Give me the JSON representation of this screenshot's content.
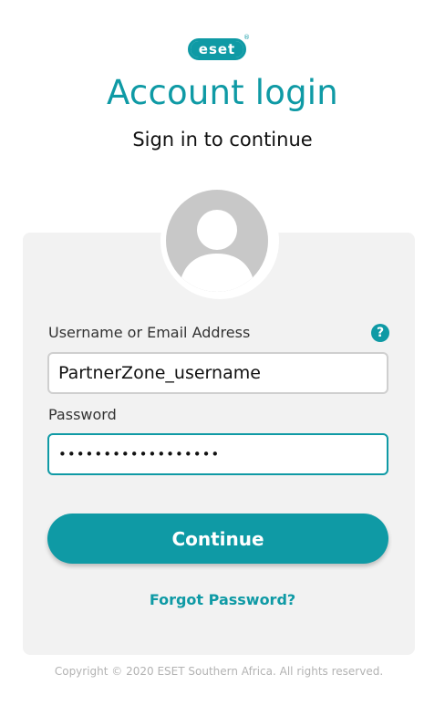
{
  "brand": {
    "logo_text": "eset",
    "registered_mark": "®",
    "accent_color": "#0f9aa5"
  },
  "header": {
    "title": "Account login",
    "subtitle": "Sign in to continue"
  },
  "avatar": {
    "icon": "user-silhouette-icon"
  },
  "form": {
    "username_label": "Username or Email Address",
    "help_icon_glyph": "?",
    "username_value": "PartnerZone_username",
    "password_label": "Password",
    "password_value": "••••••••••••••••••",
    "continue_label": "Continue",
    "forgot_label": "Forgot Password?"
  },
  "footer": {
    "copyright": "Copyright © 2020 ESET Southern Africa. All rights reserved."
  }
}
